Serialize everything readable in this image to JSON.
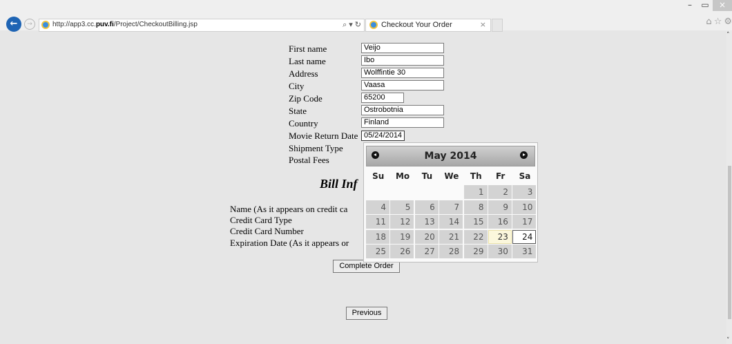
{
  "browser": {
    "url_prefix": "http://app3.cc.",
    "url_domain": "puv.fi",
    "url_suffix": "/Project/CheckoutBilling.jsp",
    "tab_title": "Checkout Your Order",
    "window_minimize": "–",
    "window_restore": "▭",
    "window_close": "×",
    "address_tools": [
      "⌕",
      "▾",
      "↻"
    ],
    "toolbar_icons": [
      "⌂",
      "☆",
      "⚙"
    ]
  },
  "shipping": {
    "first_name": {
      "label": "First name",
      "value": "Veijo"
    },
    "last_name": {
      "label": "Last name",
      "value": "Ibo"
    },
    "address": {
      "label": "Address",
      "value": "Wolffintie 30"
    },
    "city": {
      "label": "City",
      "value": "Vaasa"
    },
    "zip": {
      "label": "Zip Code",
      "value": "65200"
    },
    "state": {
      "label": "State",
      "value": "Ostrobotnia"
    },
    "country": {
      "label": "Country",
      "value": "Finland"
    },
    "return_date": {
      "label": "Movie Return Date",
      "value": "05/24/2014"
    },
    "shipment_type": {
      "label": "Shipment Type"
    },
    "postal_fees": {
      "label": "Postal Fees"
    }
  },
  "billing": {
    "title": "Bill Inf",
    "name_label": "Name (As it appears on credit ca",
    "card_type_label": "Credit Card Type",
    "card_number_label": "Credit Card Number",
    "expiration_label": "Expiration Date (As it appears or"
  },
  "buttons": {
    "complete": "Complete Order",
    "previous": "Previous"
  },
  "datepicker": {
    "month_title": "May 2014",
    "weekdays": [
      "Su",
      "Mo",
      "Tu",
      "We",
      "Th",
      "Fr",
      "Sa"
    ],
    "weeks": [
      [
        null,
        null,
        null,
        null,
        1,
        2,
        3
      ],
      [
        4,
        5,
        6,
        7,
        8,
        9,
        10
      ],
      [
        11,
        12,
        13,
        14,
        15,
        16,
        17
      ],
      [
        18,
        19,
        20,
        21,
        22,
        23,
        24
      ],
      [
        25,
        26,
        27,
        28,
        29,
        30,
        31
      ]
    ],
    "today": 23,
    "selected": 24
  }
}
